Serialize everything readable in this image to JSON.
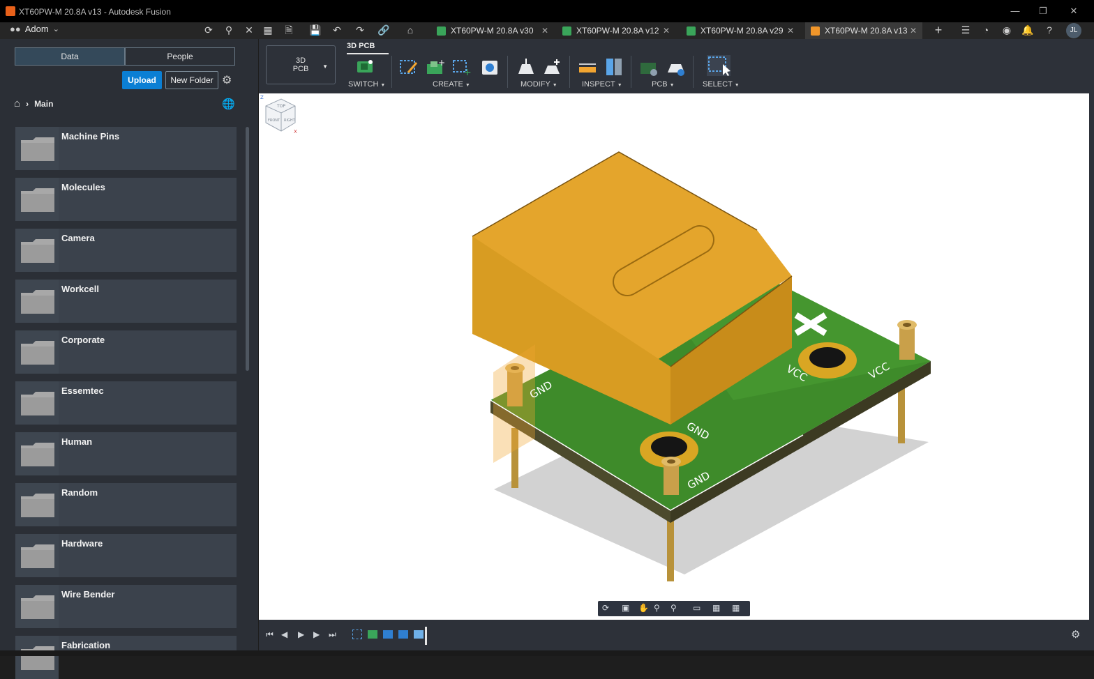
{
  "window": {
    "title": "XT60PW-M 20.8A v13 - Autodesk Fusion",
    "minimize": "—",
    "restore": "❐",
    "close": "✕"
  },
  "header": {
    "team": "Adom",
    "tabs": [
      {
        "label": "XT60PW-M 20.8A v30",
        "icon_color": "#3aa55a",
        "active": false
      },
      {
        "label": "XT60PW-M 20.8A v12",
        "icon_color": "#3aa55a",
        "active": false
      },
      {
        "label": "XT60PW-M 20.8A v29",
        "icon_color": "#3aa55a",
        "active": false
      },
      {
        "label": "XT60PW-M 20.8A v13",
        "icon_color": "#f0962a",
        "active": true
      }
    ],
    "user_initials": "JL"
  },
  "data_panel": {
    "tab_data": "Data",
    "tab_people": "People",
    "upload_label": "Upload",
    "new_folder_label": "New Folder",
    "breadcrumb": "Main",
    "folders": [
      "Machine Pins",
      "Molecules",
      "Camera",
      "Workcell",
      "Corporate",
      "Essemtec",
      "Human",
      "Random",
      "Hardware",
      "Wire Bender",
      "Fabrication"
    ]
  },
  "toolbar": {
    "workspace_line1": "3D",
    "workspace_line2": "PCB",
    "active_tab": "3D PCB",
    "groups": {
      "switch": "SWITCH",
      "create": "CREATE",
      "modify": "MODIFY",
      "inspect": "INSPECT",
      "pcb": "PCB",
      "select": "SELECT"
    }
  },
  "viewport": {
    "silk_labels": [
      "GND",
      "GND",
      "GND",
      "VCC",
      "VCC"
    ],
    "viewcube_top": "TOP",
    "viewcube_front": "FRONT",
    "viewcube_right": "RIGHT",
    "axis_z": "Z",
    "axis_x": "X"
  },
  "colors": {
    "connector_body": "#e4a52c",
    "pcb_green": "#3e8b2a",
    "pad_gold": "#d9a623",
    "accent_blue": "#0b7fd4"
  }
}
